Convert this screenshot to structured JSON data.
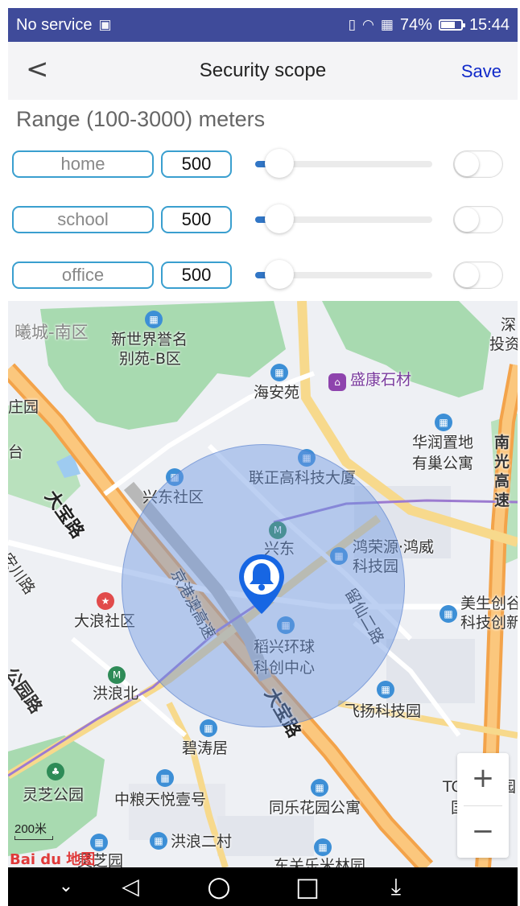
{
  "status_bar": {
    "carrier": "No service",
    "battery_percent": "74%",
    "battery_level": 0.74,
    "time": "15:44",
    "icons": [
      "sim-icon",
      "vibrate-icon",
      "wifi-icon",
      "battery-saver-icon",
      "battery-icon"
    ]
  },
  "header": {
    "back_icon": "back-chevron-icon",
    "title": "Security scope",
    "save_label": "Save"
  },
  "range_label": "Range (100-3000) meters",
  "scopes": [
    {
      "name": "home",
      "value": "500",
      "slider_fraction": 0.138,
      "enabled": false
    },
    {
      "name": "school",
      "value": "500",
      "slider_fraction": 0.138,
      "enabled": false
    },
    {
      "name": "office",
      "value": "500",
      "slider_fraction": 0.138,
      "enabled": false
    }
  ],
  "map": {
    "labels": {
      "l1": "曦城-南区",
      "l2": "新世界誉名",
      "l2b": "别苑-B区",
      "l3": "海安苑",
      "l4": "盛康石材",
      "l5": "深",
      "l5b": "投资",
      "l6": "华润置地",
      "l6b": "有巢公寓",
      "l7": "南",
      "l7b": "光",
      "l7c": "高",
      "l7d": "速",
      "l8": "兴东社区",
      "l9": "联正高科技大厦",
      "l10": "大宝路",
      "l11": "兴东",
      "l12": "鸿荣源·鸿威",
      "l12b": "科技园",
      "l13": "京港澳高速",
      "l14": "留仙二路",
      "l15": "大浪社区",
      "l16": "稻兴环球",
      "l16b": "科创中心",
      "l17": "美生创谷",
      "l17b": "科技创新",
      "l18": "洪浪北",
      "l19": "飞扬科技园",
      "l20": "公园路",
      "l21": "碧涛居",
      "l22": "大宝路",
      "l23": "灵芝公园",
      "l24": "中粮天悦壹号",
      "l25": "同乐花园公寓",
      "l26": "洪浪二村",
      "l27": "灵芝园",
      "l28": "东关乐米林园",
      "l29": "TC",
      "l30": "园",
      "l31": "国",
      "l32": "庄园",
      "l33": "台",
      "l34": "安川路"
    },
    "scale_label": "200米",
    "logo_text": "Bai du 地图",
    "zoom_in_label": "+",
    "zoom_out_label": "−",
    "pin_icon": "bell-location-pin-icon"
  },
  "nav_bar": {
    "icons": [
      "collapse-chevron-icon",
      "back-triangle-icon",
      "home-circle-icon",
      "recents-square-icon",
      "notification-pull-icon"
    ],
    "glyphs": {
      "chev": "⌄",
      "back": "◁",
      "home": "○",
      "recent": "□",
      "pull": "⤓"
    }
  }
}
